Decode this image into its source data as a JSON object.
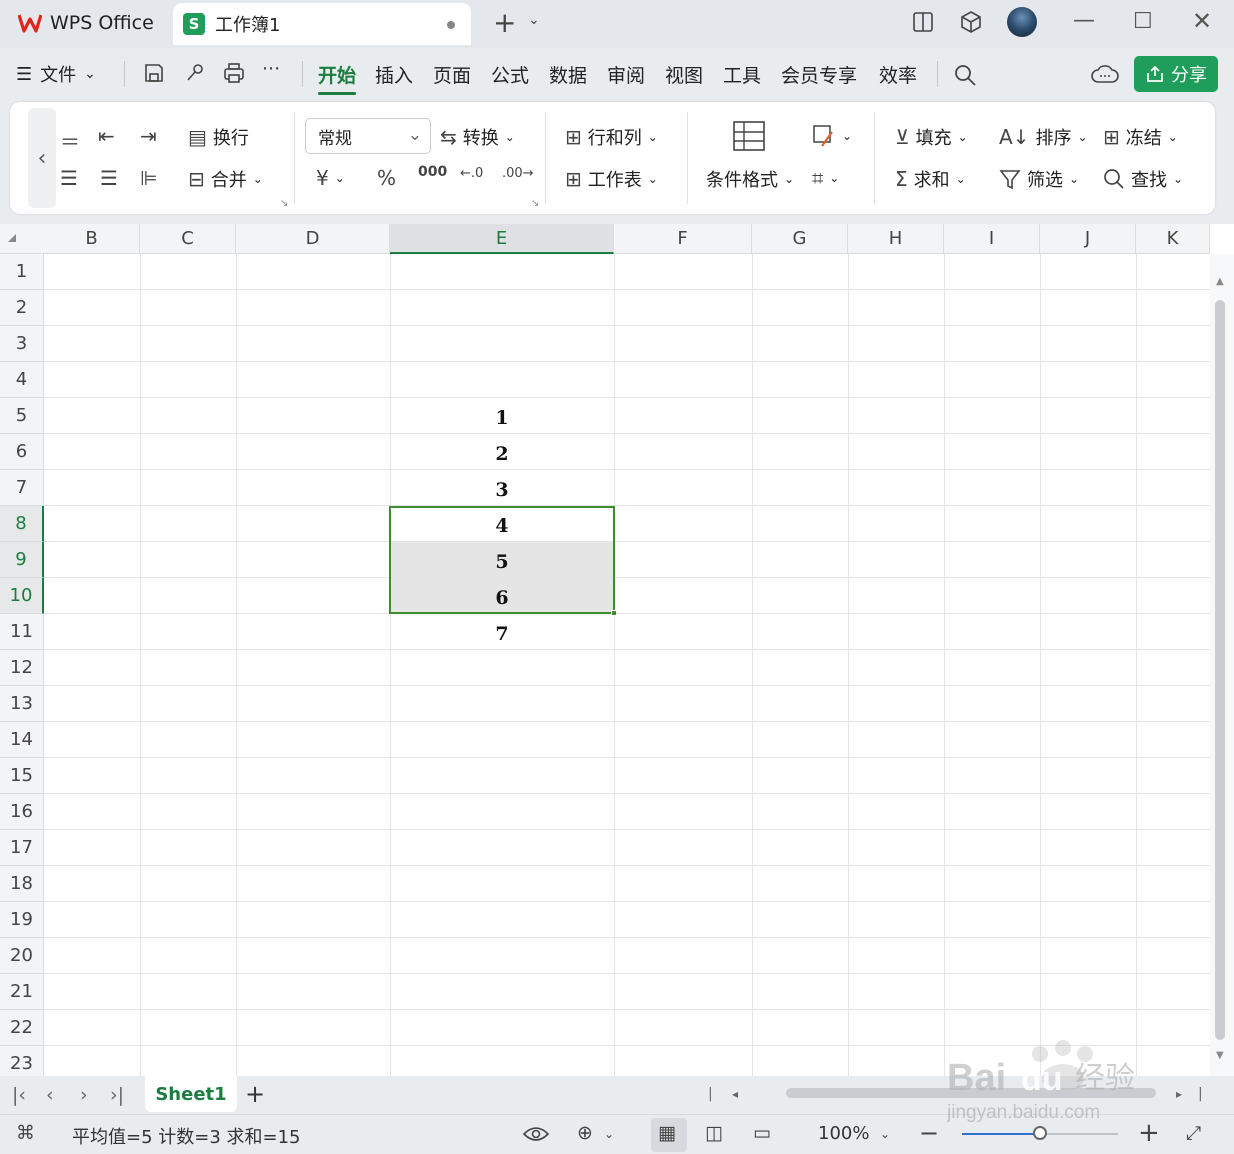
{
  "titlebar": {
    "app_tab": "WPS Office",
    "doc_tab": "工作簿1",
    "new_tab": "+"
  },
  "menubar": {
    "file_label": "文件",
    "tabs": [
      "开始",
      "插入",
      "页面",
      "公式",
      "数据",
      "审阅",
      "视图",
      "工具",
      "会员专享",
      "效率"
    ],
    "active_tab": "开始",
    "share_label": "分享"
  },
  "ribbon": {
    "wrap_label": "换行",
    "merge_label": "合并",
    "number_format": "常规",
    "convert_label": "转换",
    "rowcol_label": "行和列",
    "worksheet_label": "工作表",
    "condformat_label": "条件格式",
    "fill_label": "填充",
    "sort_label": "排序",
    "freeze_label": "冻结",
    "sum_label": "求和",
    "filter_label": "筛选",
    "find_label": "查找",
    "currency_symbol": "¥",
    "percent_symbol": "%",
    "thousands_symbol": "000",
    "inc_decimal": "←.0",
    "dec_decimal": ".00→"
  },
  "grid": {
    "columns": [
      "B",
      "C",
      "D",
      "E",
      "F",
      "G",
      "H",
      "I",
      "J",
      "K"
    ],
    "selected_column": "E",
    "rows": [
      "1",
      "2",
      "3",
      "4",
      "5",
      "6",
      "7",
      "8",
      "9",
      "10",
      "11",
      "12",
      "13",
      "14",
      "15",
      "16",
      "17",
      "18",
      "19",
      "20",
      "21",
      "22",
      "23"
    ],
    "selected_rows": [
      "8",
      "9",
      "10"
    ],
    "column_e_values": [
      {
        "row": 5,
        "value": "1"
      },
      {
        "row": 6,
        "value": "2"
      },
      {
        "row": 7,
        "value": "3"
      },
      {
        "row": 8,
        "value": "4"
      },
      {
        "row": 9,
        "value": "5"
      },
      {
        "row": 10,
        "value": "6"
      },
      {
        "row": 11,
        "value": "7"
      }
    ],
    "selection_range": "E8:E10"
  },
  "sheetbar": {
    "sheets": [
      "Sheet1"
    ],
    "active_sheet": "Sheet1"
  },
  "statusbar": {
    "summary": "平均值=5  计数=3  求和=15",
    "zoom": "100%",
    "zoom_level": 0.5
  },
  "watermark": {
    "brand": "Baidu经验",
    "url": "jingyan.baidu.com"
  },
  "colors": {
    "accent": "#1b7d3f",
    "share_button": "#1e9e5a",
    "selection_border": "#3f8b2e",
    "wps_logo": "#e0261b"
  }
}
